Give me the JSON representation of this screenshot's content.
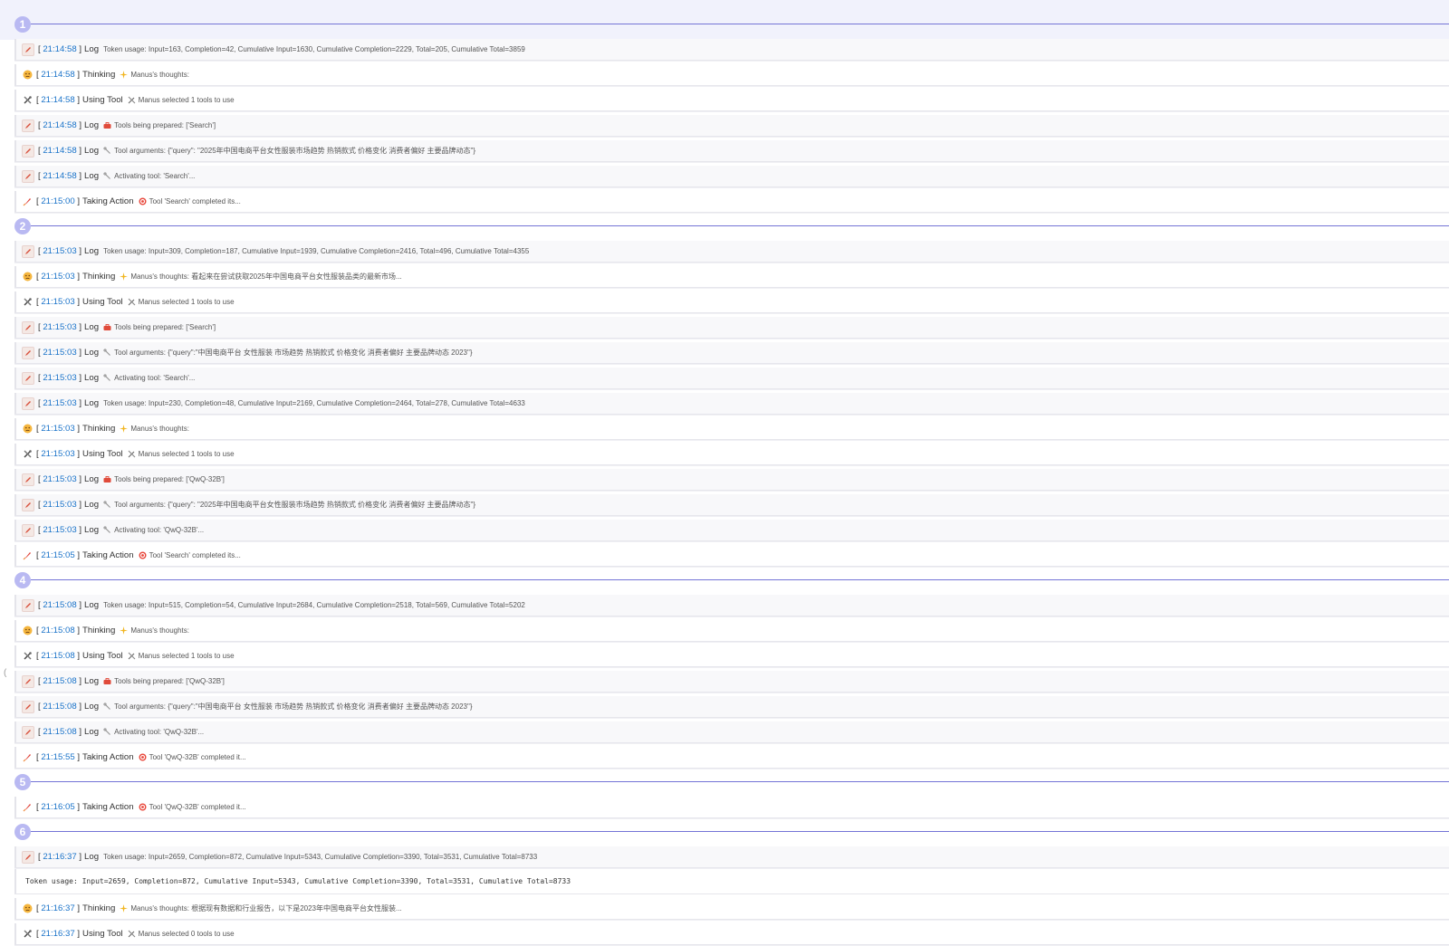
{
  "types": {
    "log": "Log",
    "thinking": "Thinking",
    "tool": "Using Tool",
    "action": "Taking Action"
  },
  "colors": {
    "accent": "#7474d6",
    "step_circle": "#b9b9f2",
    "timestamp": "#1a73c9"
  },
  "steps": [
    {
      "number": "1",
      "entries": [
        {
          "kind": "log",
          "time": "21:14:58",
          "glyph": "none",
          "message": "Token usage: Input=163, Completion=42, Cumulative Input=1630, Cumulative Completion=2229, Total=205, Cumulative Total=3859"
        },
        {
          "kind": "thinking",
          "time": "21:14:58",
          "glyph": "sparkle",
          "message": "Manus's thoughts:"
        },
        {
          "kind": "tool",
          "time": "21:14:58",
          "glyph": "tools",
          "message": "Manus selected 1 tools to use"
        },
        {
          "kind": "log",
          "time": "21:14:58",
          "glyph": "toolbox",
          "message": "Tools being prepared: ['Search']"
        },
        {
          "kind": "log",
          "time": "21:14:58",
          "glyph": "wrench",
          "message": "Tool arguments: {\"query\": \"2025年中国电商平台女性服装市场趋势 热销款式 价格变化 消费者偏好 主要品牌动态\"}"
        },
        {
          "kind": "log",
          "time": "21:14:58",
          "glyph": "wrench",
          "message": "Activating tool: 'Search'..."
        },
        {
          "kind": "action",
          "time": "21:15:00",
          "glyph": "target",
          "message": "Tool 'Search' completed its..."
        }
      ]
    },
    {
      "number": "2",
      "entries": [
        {
          "kind": "log",
          "time": "21:15:03",
          "glyph": "none",
          "message": "Token usage: Input=309, Completion=187, Cumulative Input=1939, Cumulative Completion=2416, Total=496, Cumulative Total=4355"
        },
        {
          "kind": "thinking",
          "time": "21:15:03",
          "glyph": "sparkle",
          "message": "Manus's thoughts: 看起来在尝试获取2025年中国电商平台女性服装品类的最新市场..."
        },
        {
          "kind": "tool",
          "time": "21:15:03",
          "glyph": "tools",
          "message": "Manus selected 1 tools to use"
        },
        {
          "kind": "log",
          "time": "21:15:03",
          "glyph": "toolbox",
          "message": "Tools being prepared: ['Search']"
        },
        {
          "kind": "log",
          "time": "21:15:03",
          "glyph": "wrench",
          "message": "Tool arguments: {\"query\":\"中国电商平台 女性服装 市场趋势 热销款式 价格变化 消费者偏好 主要品牌动态 2023\"}"
        },
        {
          "kind": "log",
          "time": "21:15:03",
          "glyph": "wrench",
          "message": "Activating tool: 'Search'..."
        },
        {
          "kind": "log",
          "time": "21:15:03",
          "glyph": "none",
          "message": "Token usage: Input=230, Completion=48, Cumulative Input=2169, Cumulative Completion=2464, Total=278, Cumulative Total=4633"
        },
        {
          "kind": "thinking",
          "time": "21:15:03",
          "glyph": "sparkle",
          "message": "Manus's thoughts:"
        },
        {
          "kind": "tool",
          "time": "21:15:03",
          "glyph": "tools",
          "message": "Manus selected 1 tools to use"
        },
        {
          "kind": "log",
          "time": "21:15:03",
          "glyph": "toolbox",
          "message": "Tools being prepared: ['QwQ-32B']"
        },
        {
          "kind": "log",
          "time": "21:15:03",
          "glyph": "wrench",
          "message": "Tool arguments: {\"query\": \"2025年中国电商平台女性服装市场趋势 热销款式 价格变化 消费者偏好 主要品牌动态\"}"
        },
        {
          "kind": "log",
          "time": "21:15:03",
          "glyph": "wrench",
          "message": "Activating tool: 'QwQ-32B'..."
        },
        {
          "kind": "action",
          "time": "21:15:05",
          "glyph": "target",
          "message": "Tool 'Search' completed its..."
        }
      ]
    },
    {
      "number": "4",
      "entries": [
        {
          "kind": "log",
          "time": "21:15:08",
          "glyph": "none",
          "message": "Token usage: Input=515, Completion=54, Cumulative Input=2684, Cumulative Completion=2518, Total=569, Cumulative Total=5202"
        },
        {
          "kind": "thinking",
          "time": "21:15:08",
          "glyph": "sparkle",
          "message": "Manus's thoughts:"
        },
        {
          "kind": "tool",
          "time": "21:15:08",
          "glyph": "tools",
          "message": "Manus selected 1 tools to use"
        },
        {
          "kind": "log",
          "time": "21:15:08",
          "glyph": "toolbox",
          "message": "Tools being prepared: ['QwQ-32B']"
        },
        {
          "kind": "log",
          "time": "21:15:08",
          "glyph": "wrench",
          "message": "Tool arguments: {\"query\":\"中国电商平台 女性服装 市场趋势 热销款式 价格变化 消费者偏好 主要品牌动态 2023\"}"
        },
        {
          "kind": "log",
          "time": "21:15:08",
          "glyph": "wrench",
          "message": "Activating tool: 'QwQ-32B'..."
        },
        {
          "kind": "action",
          "time": "21:15:55",
          "glyph": "target",
          "message": "Tool 'QwQ-32B' completed it..."
        }
      ]
    },
    {
      "number": "5",
      "entries": [
        {
          "kind": "action",
          "time": "21:16:05",
          "glyph": "target",
          "message": "Tool 'QwQ-32B' completed it..."
        }
      ]
    },
    {
      "number": "6",
      "entries": [
        {
          "kind": "log",
          "time": "21:16:37",
          "glyph": "none",
          "message": "Token usage: Input=2659, Completion=872, Cumulative Input=5343, Cumulative Completion=3390, Total=3531, Cumulative Total=8733",
          "expanded": "Token usage: Input=2659, Completion=872, Cumulative Input=5343, Cumulative Completion=3390, Total=3531, Cumulative Total=8733"
        },
        {
          "kind": "thinking",
          "time": "21:16:37",
          "glyph": "sparkle",
          "message": "Manus's thoughts: 根据现有数据和行业报告，以下是2023年中国电商平台女性服装..."
        },
        {
          "kind": "tool",
          "time": "21:16:37",
          "glyph": "tools",
          "message": "Manus selected 0 tools to use"
        }
      ]
    }
  ]
}
